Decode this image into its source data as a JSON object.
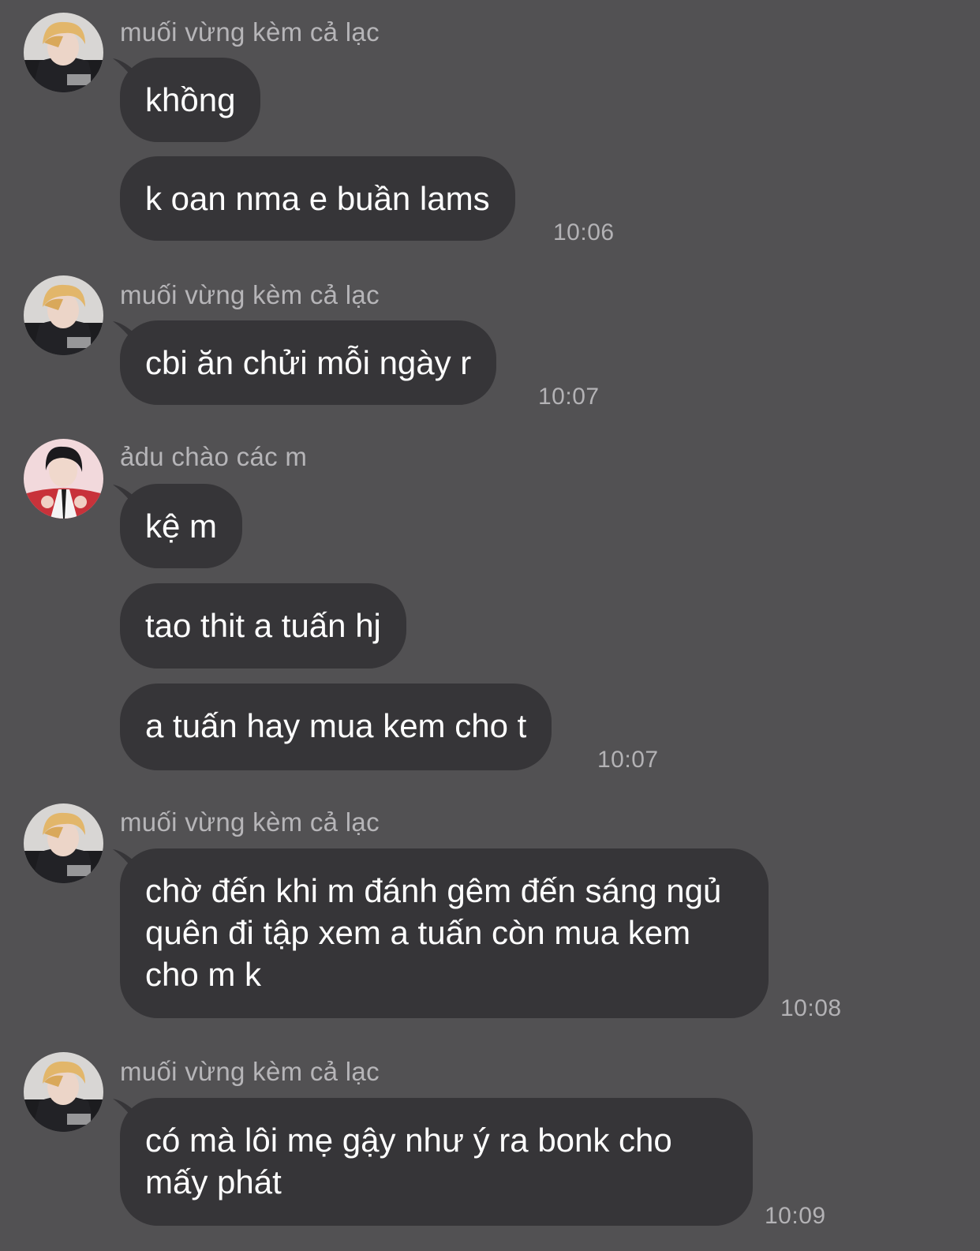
{
  "messages": [
    {
      "sender": "muối vừng kèm cả lạc",
      "avatar": "blonde-user-avatar",
      "bubbles": [
        "khồng",
        "k oan nma e buần lams"
      ],
      "time": "10:06"
    },
    {
      "sender": "muối vừng kèm cả lạc",
      "avatar": "blonde-user-avatar",
      "bubbles": [
        "cbi ăn chửi mỗi ngày r"
      ],
      "time": "10:07"
    },
    {
      "sender": "ảdu chào các m",
      "avatar": "dark-hair-user-avatar",
      "bubbles": [
        "kệ m",
        "tao thit a tuấn hj",
        "a tuấn hay mua kem cho t"
      ],
      "time": "10:07"
    },
    {
      "sender": "muối vừng kèm cả lạc",
      "avatar": "blonde-user-avatar",
      "bubbles": [
        "chờ đến khi m đánh gêm đến sáng ngủ quên đi tập xem a tuấn còn mua kem cho m k"
      ],
      "time": "10:08"
    },
    {
      "sender": "muối vừng kèm cả lạc",
      "avatar": "blonde-user-avatar",
      "bubbles": [
        "có mà lôi mẹ gậy như ý ra bonk cho mấy phát"
      ],
      "time": "10:09"
    }
  ],
  "colors": {
    "background": "#525153",
    "bubble": "#363538",
    "bubble_text": "#ffffff",
    "meta_text": "#b6b5b8"
  }
}
